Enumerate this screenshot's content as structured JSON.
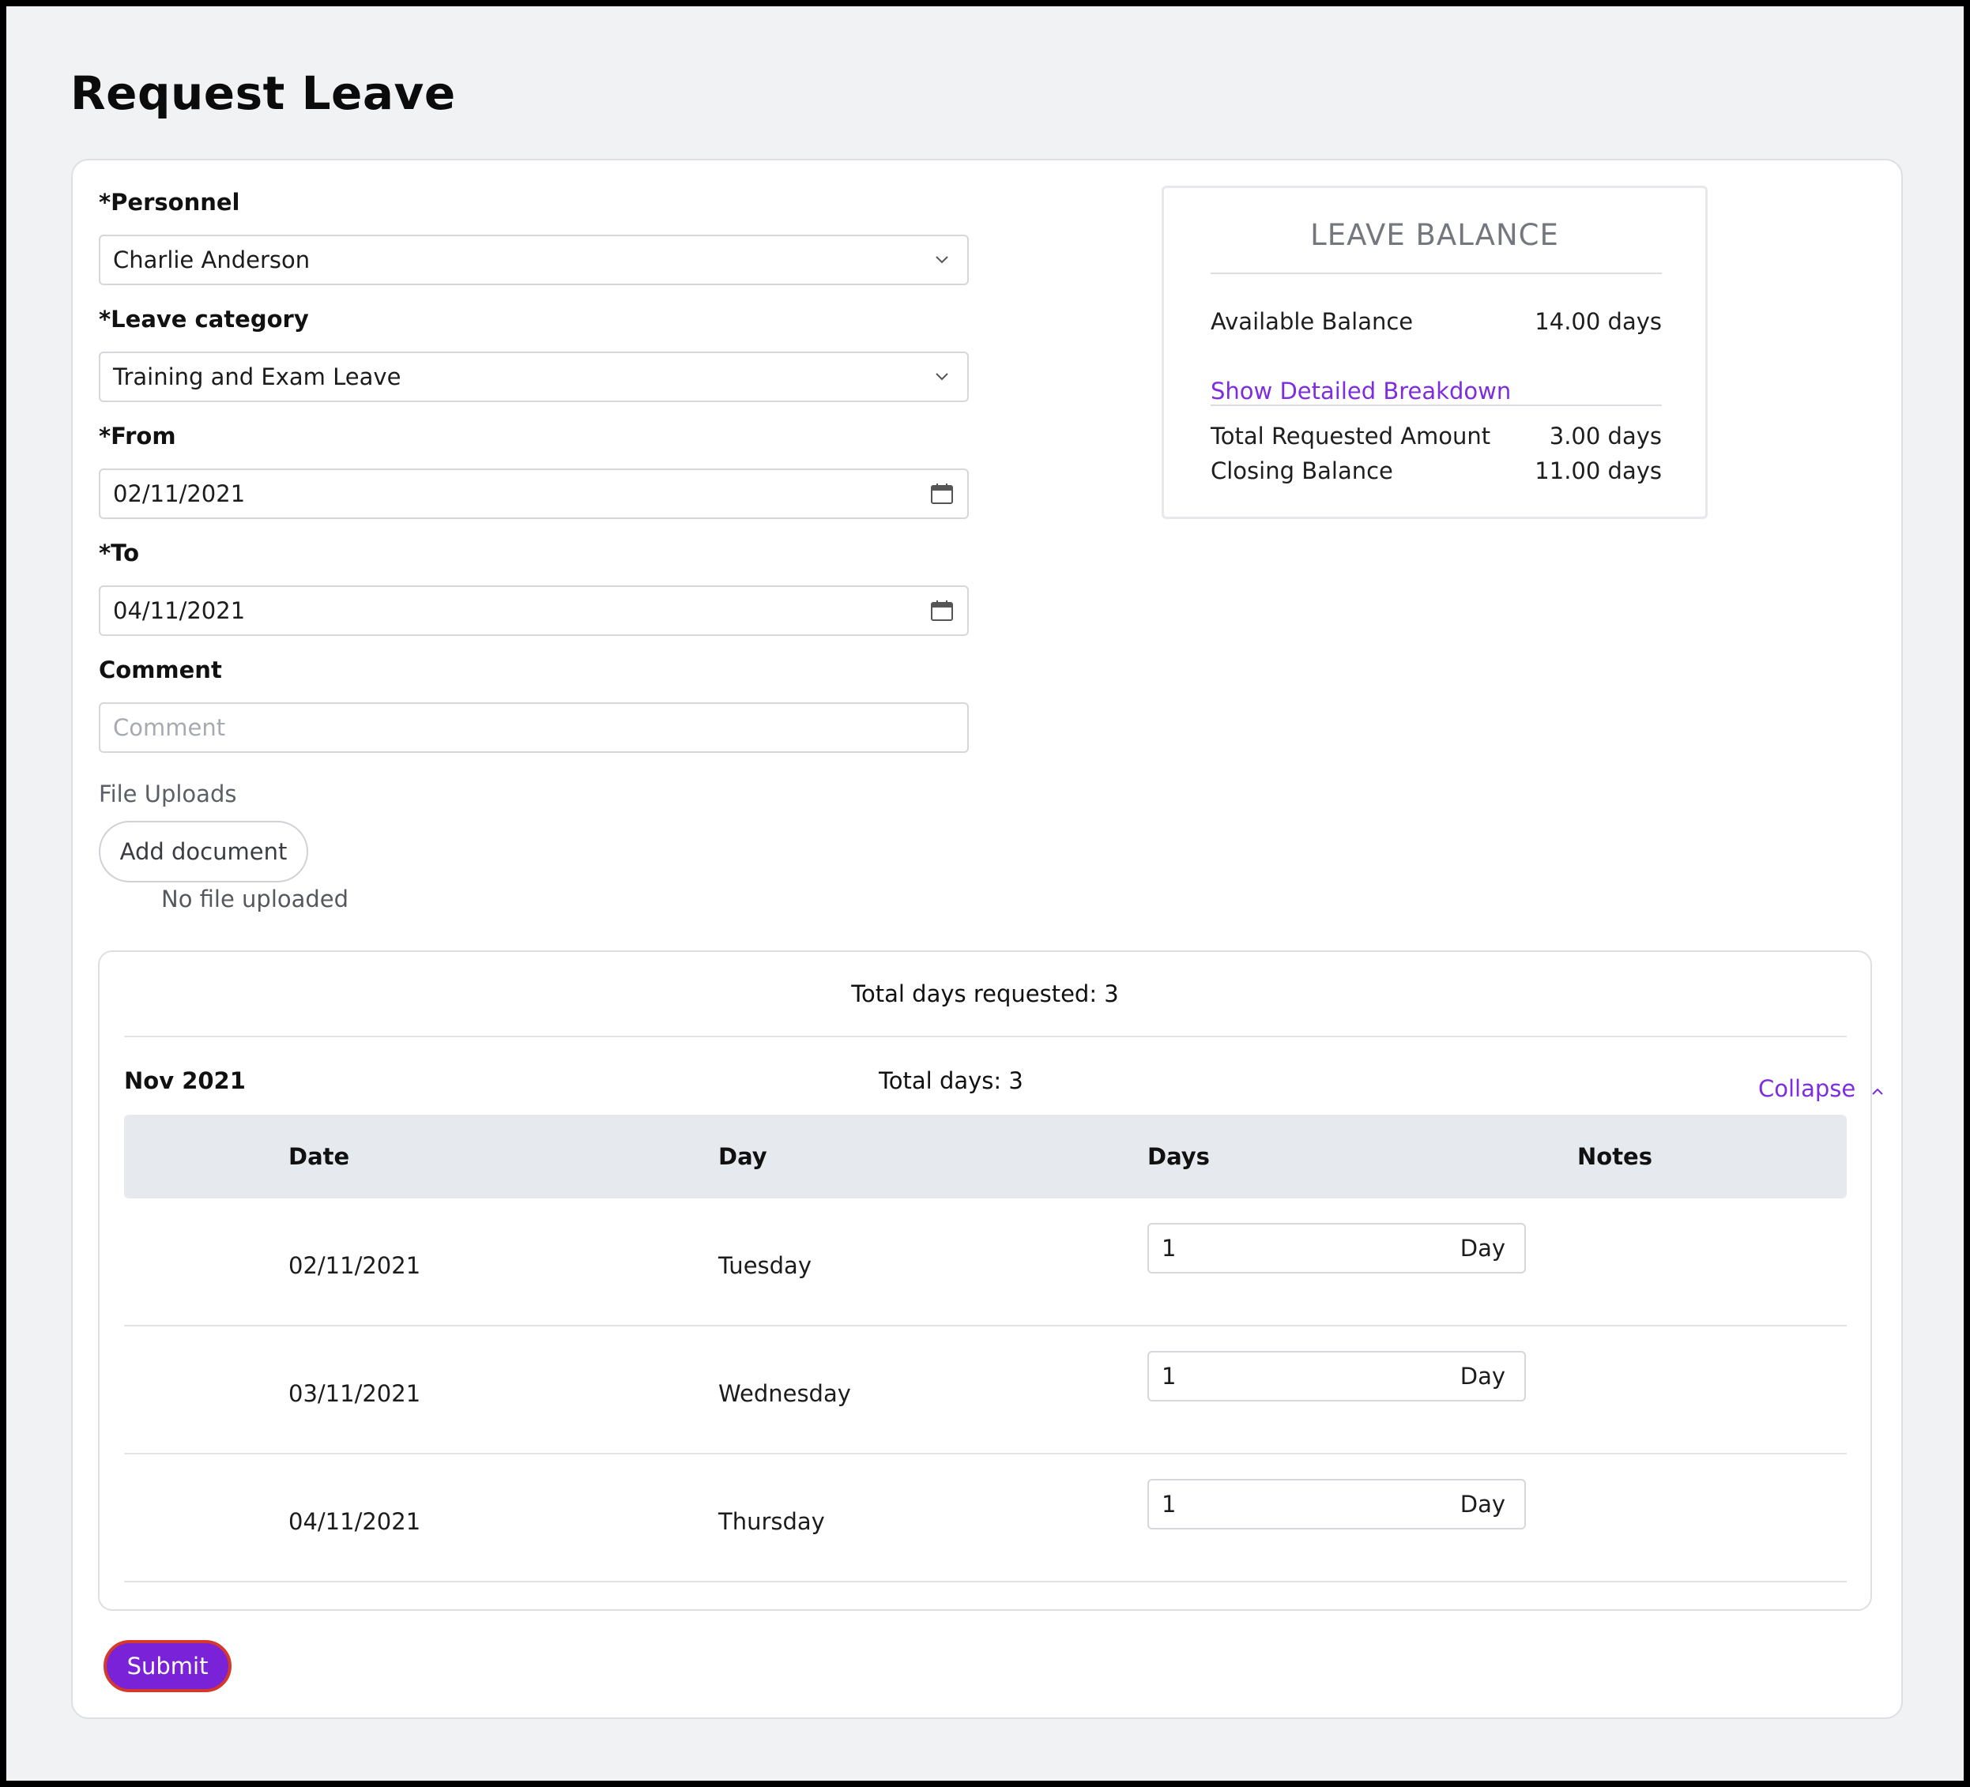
{
  "page": {
    "title": "Request Leave"
  },
  "form": {
    "personnel": {
      "label": "*Personnel",
      "value": "Charlie Anderson"
    },
    "leave_category": {
      "label": "*Leave category",
      "value": "Training and Exam Leave"
    },
    "from": {
      "label": "*From",
      "value": "02/11/2021"
    },
    "to": {
      "label": "*To",
      "value": "04/11/2021"
    },
    "comment": {
      "label": "Comment",
      "placeholder": "Comment",
      "value": ""
    },
    "uploads": {
      "label": "File Uploads",
      "button_label": "Add document",
      "status": "No file uploaded"
    },
    "submit_label": "Submit"
  },
  "balance": {
    "title": "LEAVE BALANCE",
    "available_label": "Available Balance",
    "available_value": "14.00 days",
    "breakdown_link": "Show Detailed Breakdown",
    "requested_label": "Total Requested Amount",
    "requested_value": "3.00 days",
    "closing_label": "Closing Balance",
    "closing_value": "11.00 days"
  },
  "breakdown": {
    "total_requested": "Total days requested: 3",
    "month": "Nov 2021",
    "month_total": "Total days: 3",
    "collapse_label": "Collapse",
    "columns": {
      "date": "Date",
      "day": "Day",
      "days": "Days",
      "notes": "Notes"
    },
    "rows": [
      {
        "date": "02/11/2021",
        "day": "Tuesday",
        "days": "1",
        "unit": "Day"
      },
      {
        "date": "03/11/2021",
        "day": "Wednesday",
        "days": "1",
        "unit": "Day"
      },
      {
        "date": "04/11/2021",
        "day": "Thursday",
        "days": "1",
        "unit": "Day"
      }
    ]
  },
  "colors": {
    "accent": "#7a22d8",
    "link": "#7d2ce0",
    "submit_border": "#d6382c",
    "page_bg": "#f1f2f4"
  },
  "icons": {
    "select": "chevron-down-icon",
    "date": "calendar-icon",
    "collapse": "chevron-up-icon"
  }
}
